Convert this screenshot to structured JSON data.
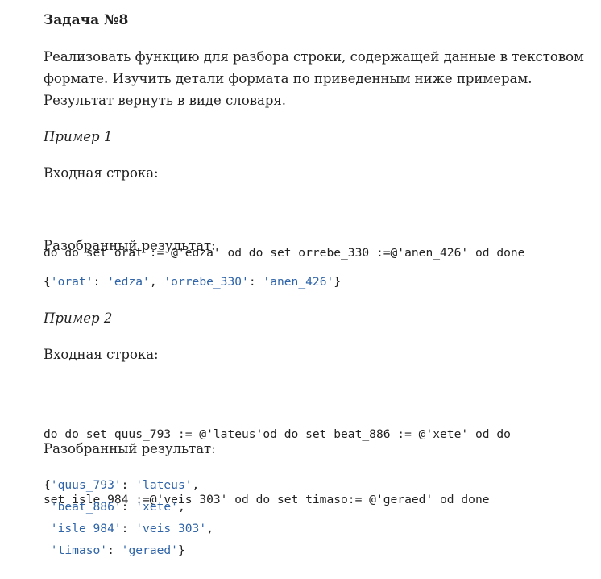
{
  "task": {
    "title": "Задача №8",
    "description_lines": [
      "Реализовать функцию для разбора строки, содержащей данные в текстовом",
      "формате. Изучить детали формата по приведенным ниже примерам.",
      "Результат вернуть в виде словаря."
    ]
  },
  "examples": [
    {
      "heading": "Пример 1",
      "input_label": "Входная строка:",
      "input_lines": [
        "do do set orat := @'edza' od do set orrebe_330 :=@'anen_426' od done"
      ],
      "output_label": "Разобранный результат:",
      "output_lines": [
        [
          {
            "t": "{",
            "s": false
          },
          {
            "t": "'orat'",
            "s": true
          },
          {
            "t": ": ",
            "s": false
          },
          {
            "t": "'edza'",
            "s": true
          },
          {
            "t": ", ",
            "s": false
          },
          {
            "t": "'orrebe_330'",
            "s": true
          },
          {
            "t": ": ",
            "s": false
          },
          {
            "t": "'anen_426'",
            "s": true
          },
          {
            "t": "}",
            "s": false
          }
        ]
      ]
    },
    {
      "heading": "Пример 2",
      "input_label": "Входная строка:",
      "input_lines": [
        "do do set quus_793 := @'lateus'od do set beat_886 := @'xete' od do",
        "set isle_984 :=@'veis_303' od do set timaso:= @'geraed' od done"
      ],
      "output_label": "Разобранный результат:",
      "output_lines": [
        [
          {
            "t": "{",
            "s": false
          },
          {
            "t": "'quus_793'",
            "s": true
          },
          {
            "t": ": ",
            "s": false
          },
          {
            "t": "'lateus'",
            "s": true
          },
          {
            "t": ",",
            "s": false
          }
        ],
        [
          {
            "t": " ",
            "s": false
          },
          {
            "t": "'beat_886'",
            "s": true
          },
          {
            "t": ": ",
            "s": false
          },
          {
            "t": "'xete'",
            "s": true
          },
          {
            "t": ",",
            "s": false
          }
        ],
        [
          {
            "t": " ",
            "s": false
          },
          {
            "t": "'isle_984'",
            "s": true
          },
          {
            "t": ": ",
            "s": false
          },
          {
            "t": "'veis_303'",
            "s": true
          },
          {
            "t": ",",
            "s": false
          }
        ],
        [
          {
            "t": " ",
            "s": false
          },
          {
            "t": "'timaso'",
            "s": true
          },
          {
            "t": ": ",
            "s": false
          },
          {
            "t": "'geraed'",
            "s": true
          },
          {
            "t": "}",
            "s": false
          }
        ]
      ]
    }
  ],
  "colors": {
    "text": "#222222",
    "string_literal": "#2f64a8",
    "background": "#ffffff"
  }
}
